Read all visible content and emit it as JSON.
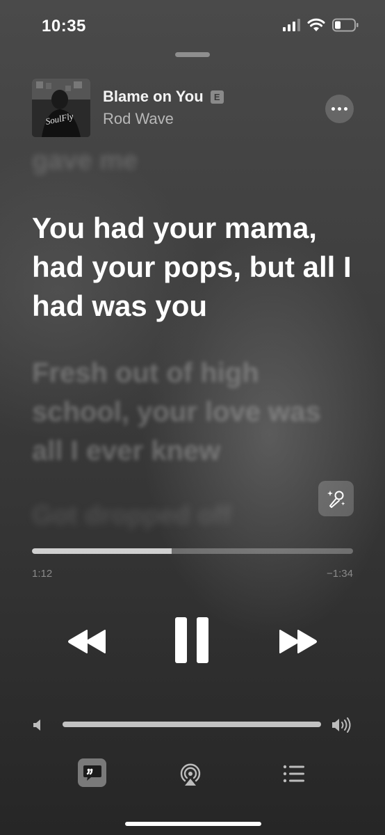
{
  "status_bar": {
    "time": "10:35"
  },
  "now_playing": {
    "title": "Blame on You",
    "explicit_badge": "E",
    "artist": "Rod Wave",
    "album_art_text": "SoulFly"
  },
  "lyrics": {
    "previous": "gave me",
    "current": "You had your mama, had your pops, but all I had was you",
    "next": "Fresh out of high school, your love was all I ever knew",
    "after_next": "Got dropped off"
  },
  "playback": {
    "elapsed": "1:12",
    "remaining": "−1:34",
    "progress_fraction": 0.435
  },
  "volume": {
    "level_fraction": 1.0
  },
  "colors": {
    "accent_text": "#ffffff",
    "secondary_text": "#b8b8b8"
  },
  "icons": {
    "more": "ellipsis-icon",
    "sing": "microphone-sparkle-icon",
    "rewind": "rewind-icon",
    "pause": "pause-icon",
    "forward": "fast-forward-icon",
    "volume_low": "speaker-low-icon",
    "volume_high": "speaker-high-icon",
    "lyrics": "lyrics-bubble-icon",
    "airplay": "airplay-icon",
    "queue": "queue-list-icon"
  }
}
